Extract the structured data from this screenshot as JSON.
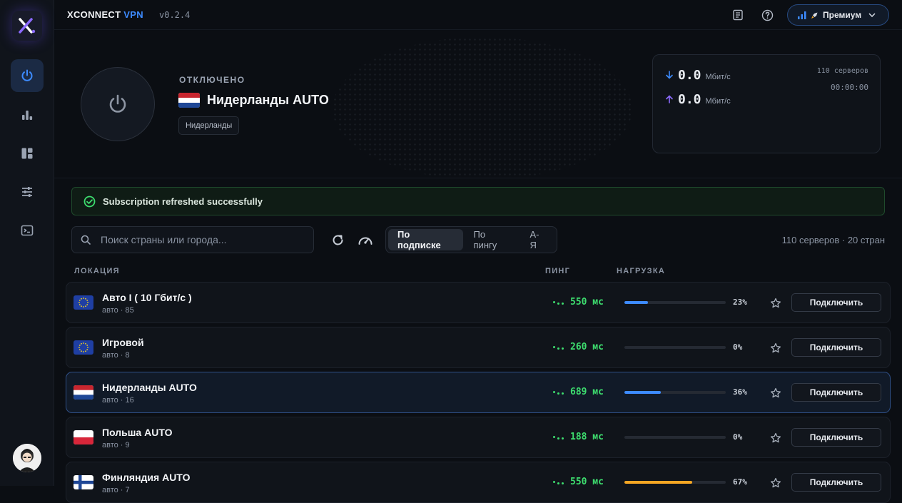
{
  "app": {
    "brand_main": "XCONNECT",
    "brand_accent": "VPN",
    "version": "v0.2.4",
    "plan_label": "Премиум"
  },
  "sidebar": {
    "items": [
      {
        "icon": "power-icon",
        "active": true
      },
      {
        "icon": "bar-chart-icon",
        "active": false
      },
      {
        "icon": "dashboard-icon",
        "active": false
      },
      {
        "icon": "sliders-icon",
        "active": false
      },
      {
        "icon": "terminal-icon",
        "active": false
      }
    ]
  },
  "hero": {
    "status": "ОТКЛЮЧЕНО",
    "location_name": "Нидерланды AUTO",
    "location_tag": "Нидерланды"
  },
  "stats": {
    "download_value": "0.0",
    "download_unit": "Мбит/с",
    "upload_value": "0.0",
    "upload_unit": "Мбит/с",
    "servers": "110 серверов",
    "timer": "00:00:00"
  },
  "toast": {
    "message": "Subscription refreshed successfully"
  },
  "toolbar": {
    "search_placeholder": "Поиск страны или города...",
    "sort_options": [
      "По подписке",
      "По пингу",
      "А-Я"
    ],
    "active_sort": 0,
    "summary": "110 серверов · 20 стран"
  },
  "table": {
    "headers": {
      "location": "ЛОКАЦИЯ",
      "ping": "ПИНГ",
      "load": "НАГРУЗКА"
    },
    "connect_label": "Подключить",
    "rows": [
      {
        "name": "Авто I ( 10 Гбит/с )",
        "sub": "авто · 85",
        "flag": "eu",
        "ping": "550 мс",
        "load_pct": "23%",
        "load": 0.23,
        "load_color": "#3d8bff",
        "selected": false
      },
      {
        "name": "Игровой",
        "sub": "авто · 8",
        "flag": "eu",
        "ping": "260 мс",
        "load_pct": "0%",
        "load": 0.0,
        "load_color": "#3d8bff",
        "selected": false
      },
      {
        "name": "Нидерланды AUTO",
        "sub": "авто · 16",
        "flag": "nl",
        "ping": "689 мс",
        "load_pct": "36%",
        "load": 0.36,
        "load_color": "#3d8bff",
        "selected": true
      },
      {
        "name": "Польша AUTO",
        "sub": "авто · 9",
        "flag": "pl",
        "ping": "188 мс",
        "load_pct": "0%",
        "load": 0.0,
        "load_color": "#3d8bff",
        "selected": false
      },
      {
        "name": "Финляндия AUTO",
        "sub": "авто · 7",
        "flag": "fi",
        "ping": "550 мс",
        "load_pct": "67%",
        "load": 0.67,
        "load_color": "#f5a623",
        "selected": false
      }
    ]
  },
  "colors": {
    "accent": "#3d8bff",
    "success": "#3ddc6e",
    "warning": "#f5a623"
  }
}
